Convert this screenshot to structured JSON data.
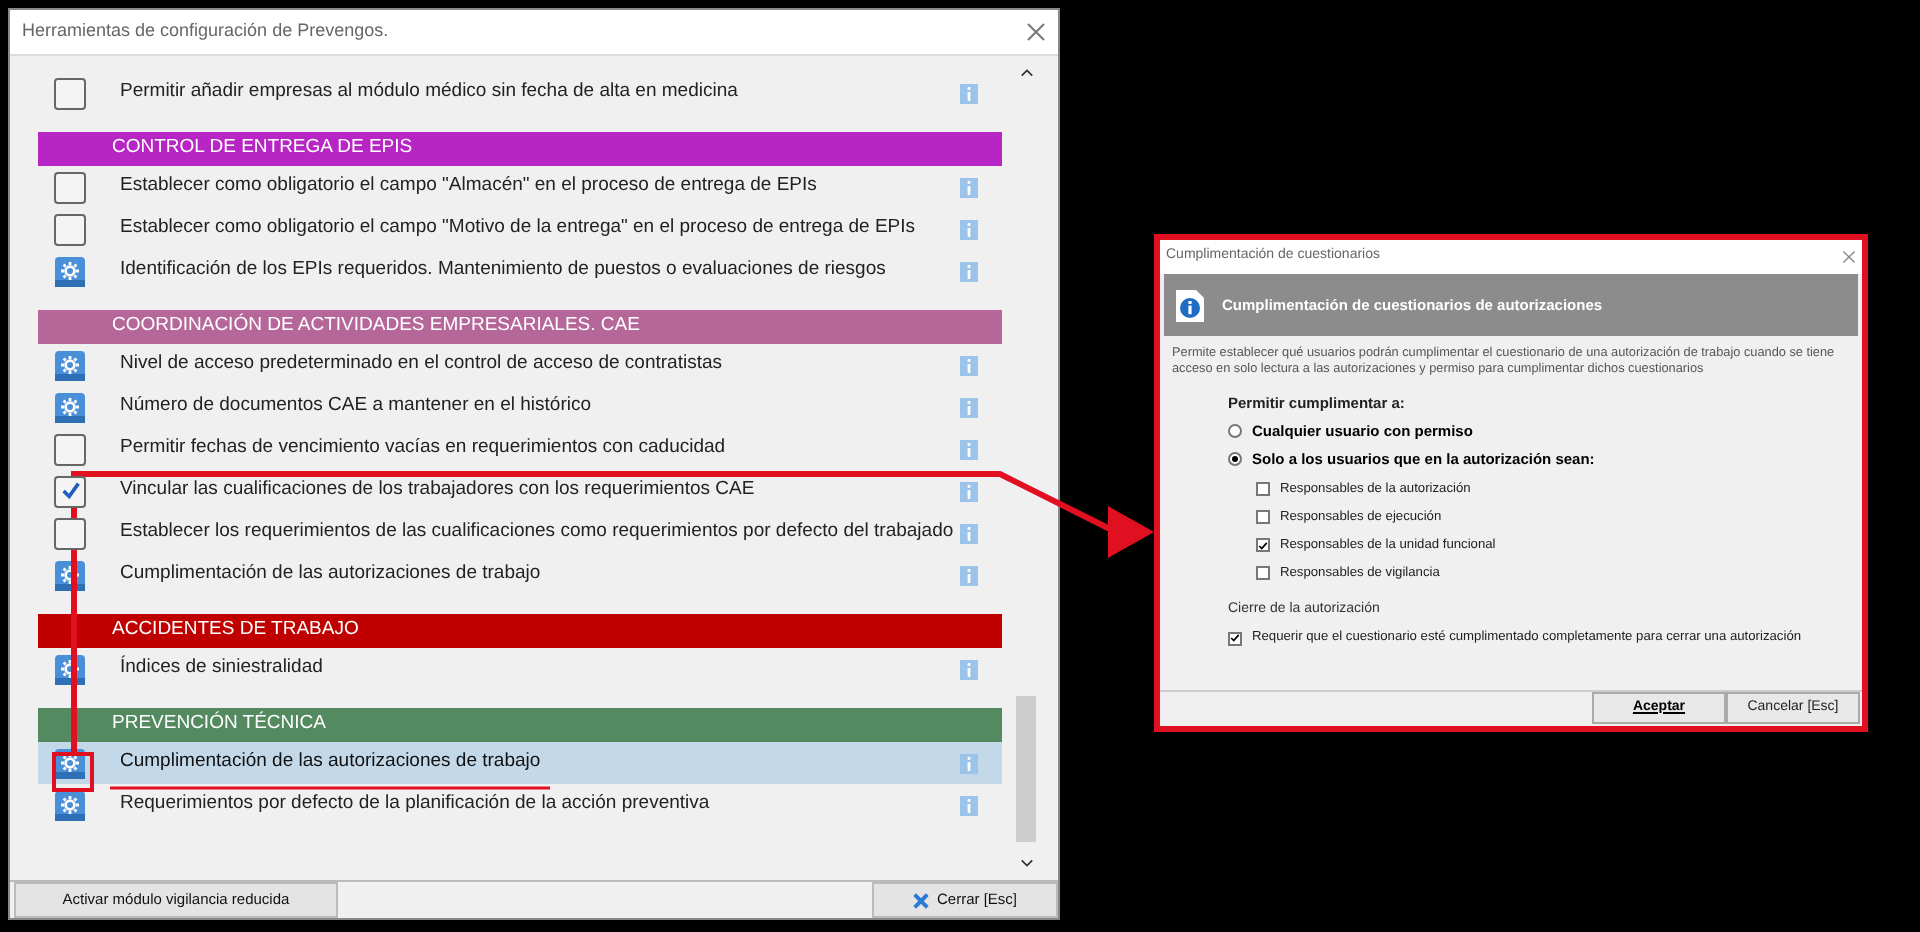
{
  "main_window": {
    "title": "Herramientas de configuración de Prevengos.",
    "sections": [
      {
        "items": [
          {
            "kind": "checkbox",
            "checked": false,
            "selected": false,
            "label": "Permitir añadir empresas al módulo médico sin fecha de alta en medicina"
          }
        ]
      },
      {
        "header": "CONTROL DE ENTREGA DE EPIS",
        "color": "#b726c4",
        "items": [
          {
            "kind": "checkbox",
            "checked": false,
            "selected": false,
            "label": "Establecer como obligatorio el campo \"Almacén\" en el proceso de entrega de EPIs"
          },
          {
            "kind": "checkbox",
            "checked": false,
            "selected": false,
            "label": "Establecer como obligatorio el campo \"Motivo de la entrega\" en el proceso de entrega de EPIs"
          },
          {
            "kind": "setting",
            "selected": false,
            "label": "Identificación de los EPIs requeridos. Mantenimiento de puestos o evaluaciones de riesgos"
          }
        ]
      },
      {
        "header": "COORDINACIÓN DE ACTIVIDADES EMPRESARIALES. CAE",
        "color": "#b5679a",
        "items": [
          {
            "kind": "setting",
            "selected": false,
            "label": "Nivel de acceso predeterminado en el control de acceso de contratistas"
          },
          {
            "kind": "setting",
            "selected": false,
            "label": "Número de documentos CAE a mantener en el histórico"
          },
          {
            "kind": "checkbox",
            "checked": false,
            "selected": false,
            "label": "Permitir fechas de vencimiento vacías en requerimientos con caducidad"
          },
          {
            "kind": "checkbox",
            "checked": true,
            "selected": false,
            "label": "Vincular las cualificaciones de los trabajadores con los requerimientos CAE"
          },
          {
            "kind": "checkbox",
            "checked": false,
            "selected": false,
            "label": "Establecer los requerimientos de las cualificaciones como requerimientos por defecto del trabajado"
          },
          {
            "kind": "setting",
            "selected": false,
            "label": "Cumplimentación de las autorizaciones de trabajo"
          }
        ]
      },
      {
        "header": "ACCIDENTES DE TRABAJO",
        "color": "#c00000",
        "items": [
          {
            "kind": "setting",
            "selected": false,
            "label": "Índices de siniestralidad"
          }
        ]
      },
      {
        "header": "PREVENCIÓN TÉCNICA",
        "color": "#548a60",
        "items": [
          {
            "kind": "setting",
            "selected": true,
            "label": "Cumplimentación de las autorizaciones de trabajo"
          },
          {
            "kind": "setting",
            "selected": false,
            "label": "Requerimientos por defecto de la planificación de la acción preventiva"
          }
        ]
      }
    ],
    "footer_buttons": [
      {
        "kind": "plain",
        "label": "Activar módulo vigilancia reducida"
      },
      {
        "kind": "close",
        "label": "Cerrar  [Esc]"
      }
    ]
  },
  "dialog": {
    "title": "Cumplimentación de cuestionarios",
    "header": "Cumplimentación de cuestionarios de autorizaciones",
    "description": "Permite establecer qué usuarios podrán cumplimentar el cuestionario de una autorización de trabajo cuando se tiene acceso en solo lectura a las autorizaciones y permiso para cumplimentar dichos cuestionarios",
    "group_label": "Permitir cumplimentar a:",
    "radios": [
      {
        "label": "Cualquier usuario con permiso",
        "selected": false
      },
      {
        "label": "Solo a los usuarios que en la autorización sean:",
        "selected": true
      }
    ],
    "roles": [
      {
        "label": "Responsables de la autorización",
        "checked": false
      },
      {
        "label": "Responsables de ejecución",
        "checked": false
      },
      {
        "label": "Responsables de la unidad funcional",
        "checked": true
      },
      {
        "label": "Responsables de vigilancia",
        "checked": false
      }
    ],
    "close_label": "Cierre de la autorización",
    "close_option": {
      "label": "Requerir que el cuestionario esté cumplimentado completamente para cerrar una autorización",
      "checked": true
    },
    "buttons": [
      {
        "label": "Aceptar",
        "default": true
      },
      {
        "label": "Cancelar  [Esc]",
        "default": false
      }
    ]
  }
}
